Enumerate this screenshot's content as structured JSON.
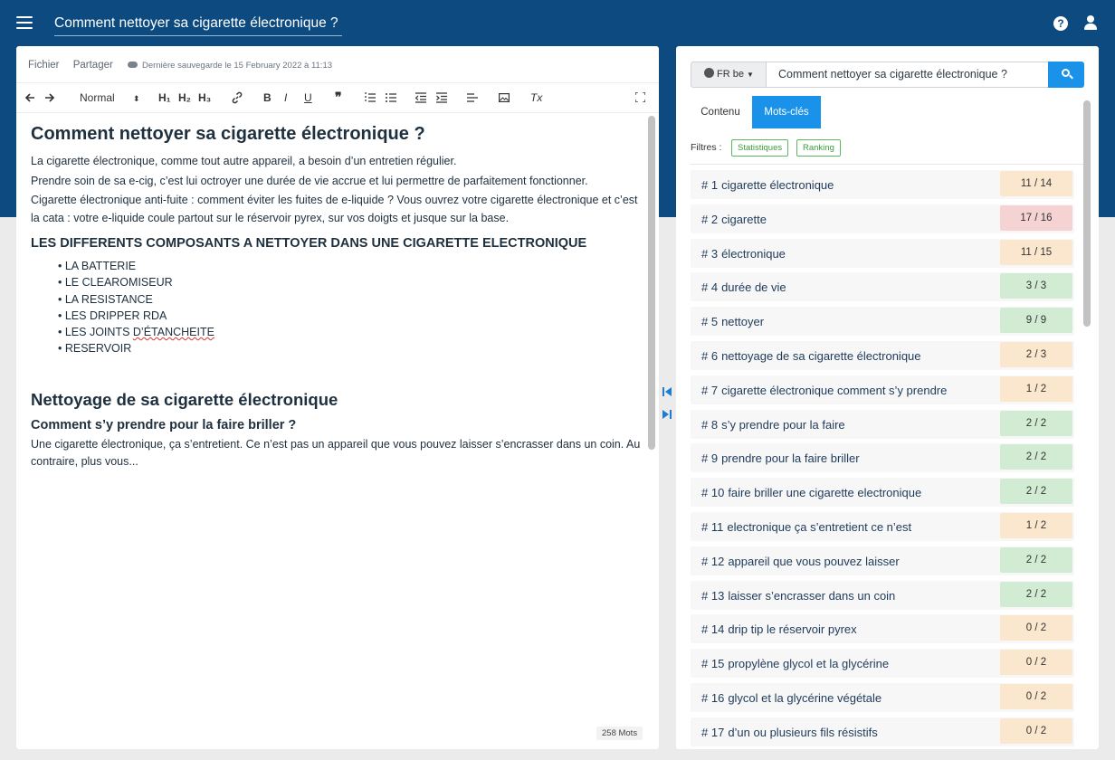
{
  "header": {
    "title": "Comment nettoyer sa cigarette électronique ?",
    "help_icon": "?"
  },
  "editor": {
    "menu": {
      "file": "Fichier",
      "share": "Partager"
    },
    "saved": "Dernière sauvegarde le 15 February 2022 à 11:13",
    "toolbar": {
      "format": "Normal",
      "h1": "H₁",
      "h2": "H₂",
      "h3": "H₃",
      "bold": "B",
      "italic": "I",
      "underline": "U",
      "quote": "❞",
      "clear_format": "Tx"
    },
    "doc": {
      "h1": "Comment nettoyer sa cigarette électronique ?",
      "p1": "La cigarette électronique, comme tout autre appareil, a besoin d’un entretien régulier.",
      "p2": "Prendre soin de sa e-cig, c’est lui octroyer une durée de vie accrue et lui permettre de parfaitement fonctionner.",
      "p3": "Cigarette électronique anti-fuite : comment éviter les fuites de e-liquide ? Vous ouvrez votre cigarette électronique et c’est la cata : votre e-liquide coule partout sur le réservoir pyrex, sur vos doigts et jusque sur la base.",
      "h2": "LES DIFFERENTS COMPOSANTS A NETTOYER DANS UNE CIGARETTE ELECTRONIQUE",
      "items": [
        "LA BATTERIE",
        "LE CLEAROMISEUR",
        "LA RESISTANCE",
        "LES DRIPPER RDA"
      ],
      "item5_a": "LES JOINTS ",
      "item5_b": "D’ÉTANCHEITE",
      "item6": "RESERVOIR",
      "h1b": "Nettoyage de sa cigarette électronique",
      "h3": "Comment s’y prendre pour la faire briller ?",
      "p4": "Une cigarette électronique, ça s’entretient. Ce n’est pas un appareil que vous pouvez laisser s’encrasser dans un coin. Au contraire, plus vous..."
    },
    "word_count": "258 Mots"
  },
  "panel": {
    "lang": "FR be",
    "query": "Comment nettoyer sa cigarette électronique ?",
    "tabs": {
      "content": "Contenu",
      "keywords": "Mots-clés"
    },
    "filters_label": "Filtres :",
    "filters": {
      "stats": "Statistiques",
      "ranking": "Ranking"
    },
    "keywords": [
      {
        "num": "# 1",
        "text": "cigarette électronique",
        "score": "11 / 14",
        "color": "#fbe6ce"
      },
      {
        "num": "# 2",
        "text": "cigarette",
        "score": "17 / 16",
        "color": "#f6d3d3"
      },
      {
        "num": "# 3",
        "text": "électronique",
        "score": "11 / 15",
        "color": "#fbe6ce"
      },
      {
        "num": "# 4",
        "text": "durée de vie",
        "score": "3 / 3",
        "color": "#d1ecd2"
      },
      {
        "num": "# 5",
        "text": "nettoyer",
        "score": "9 / 9",
        "color": "#d1ecd2"
      },
      {
        "num": "# 6",
        "text": "nettoyage de sa cigarette électronique",
        "score": "2 / 3",
        "color": "#fbe6ce"
      },
      {
        "num": "# 7",
        "text": "cigarette électronique comment s’y prendre",
        "score": "1 / 2",
        "color": "#fbe6ce"
      },
      {
        "num": "# 8",
        "text": "s’y prendre pour la faire",
        "score": "2 / 2",
        "color": "#d1ecd2"
      },
      {
        "num": "# 9",
        "text": "prendre pour la faire briller",
        "score": "2 / 2",
        "color": "#d1ecd2"
      },
      {
        "num": "# 10",
        "text": "faire briller une cigarette electronique",
        "score": "2 / 2",
        "color": "#d1ecd2"
      },
      {
        "num": "# 11",
        "text": "electronique ça s’entretient ce n’est",
        "score": "1 / 2",
        "color": "#fbe6ce"
      },
      {
        "num": "# 12",
        "text": "appareil que vous pouvez laisser",
        "score": "2 / 2",
        "color": "#d1ecd2"
      },
      {
        "num": "# 13",
        "text": "laisser s’encrasser dans un coin",
        "score": "2 / 2",
        "color": "#d1ecd2"
      },
      {
        "num": "# 14",
        "text": "drip tip le réservoir pyrex",
        "score": "0 / 2",
        "color": "#fbe6ce"
      },
      {
        "num": "# 15",
        "text": "propylène glycol et la glycérine",
        "score": "0 / 2",
        "color": "#fbe6ce"
      },
      {
        "num": "# 16",
        "text": "glycol et la glycérine végétale",
        "score": "0 / 2",
        "color": "#fbe6ce"
      },
      {
        "num": "# 17",
        "text": "d’un ou plusieurs fils résistifs",
        "score": "0 / 2",
        "color": "#fbe6ce"
      }
    ]
  }
}
